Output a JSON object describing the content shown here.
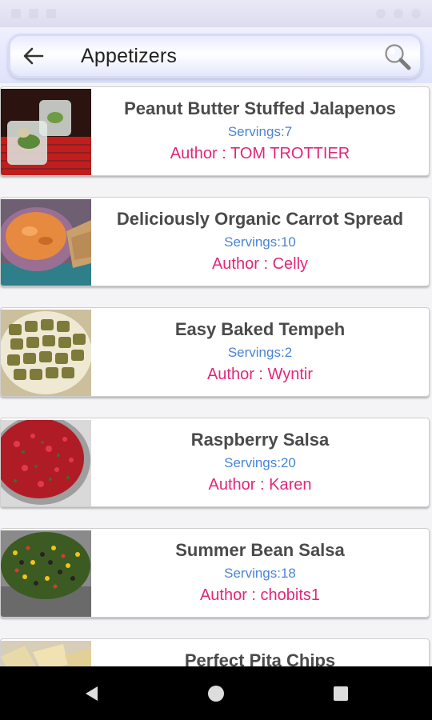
{
  "app_bar": {
    "title": "Appetizers",
    "back_icon": "arrow-left-icon",
    "search_icon": "magnifier-icon",
    "accent": "#dfe3fb"
  },
  "recipes": [
    {
      "title": "Peanut Butter Stuffed Jalapenos",
      "servings": "Servings:7",
      "author": "Author : TOM TROTTIER"
    },
    {
      "title": "Deliciously Organic Carrot Spread",
      "servings": "Servings:10",
      "author": "Author : Celly"
    },
    {
      "title": "Easy Baked Tempeh",
      "servings": "Servings:2",
      "author": "Author : Wyntir"
    },
    {
      "title": "Raspberry Salsa",
      "servings": "Servings:20",
      "author": "Author : Karen"
    },
    {
      "title": "Summer Bean Salsa",
      "servings": "Servings:18",
      "author": "Author : chobits1"
    },
    {
      "title": "Perfect Pita Chips",
      "servings": "",
      "author": ""
    }
  ],
  "colors": {
    "servings": "#4a84d6",
    "author": "#e3277a",
    "title": "#4a4a4a"
  },
  "nav_bar": {
    "back": "triangle-back-icon",
    "home": "circle-home-icon",
    "recents": "square-recents-icon"
  }
}
